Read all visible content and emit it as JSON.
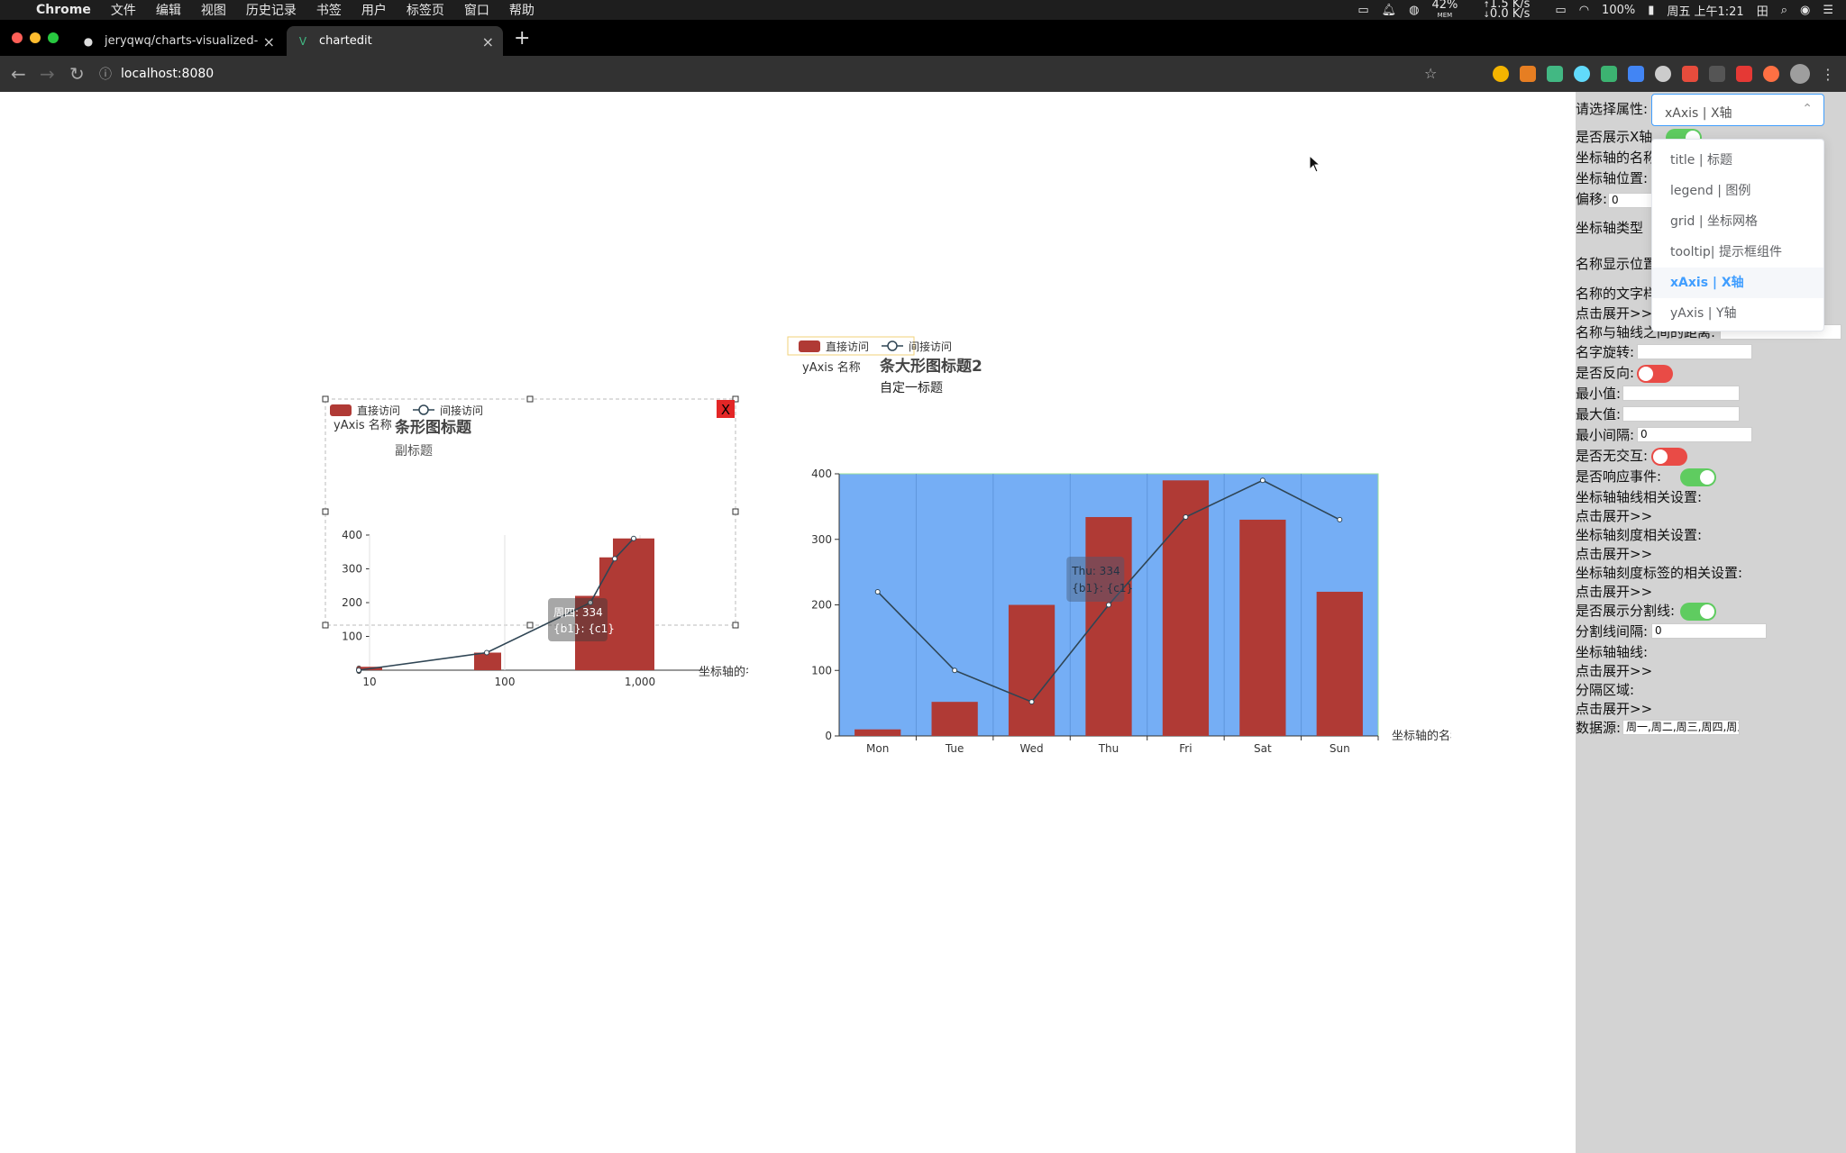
{
  "menubar": {
    "app": "Chrome",
    "items": [
      "文件",
      "编辑",
      "视图",
      "历史记录",
      "书签",
      "用户",
      "标签页",
      "窗口",
      "帮助"
    ],
    "status": {
      "mem": "42%",
      "mem_label": "MEM",
      "net_up": "1.5 K/s",
      "net_down": "0.0 K/s",
      "battery": "100%",
      "clock": "周五 上午1:21"
    }
  },
  "tabs": [
    {
      "title": "jeryqwq/charts-visualized-edit: [",
      "icon": "github-icon"
    },
    {
      "title": "chartedit",
      "icon": "vue-icon"
    }
  ],
  "address": {
    "url": "localhost:8080"
  },
  "colors": {
    "bar": "#b03a35",
    "line": "#2f4554",
    "plotbg": "#75aef5",
    "panel": "#d3d3d3",
    "accent": "#409eff"
  },
  "chart_data": [
    {
      "type": "bar",
      "title": "条形图标题",
      "subtitle": "副标题",
      "ylabel": "yAxis 名称",
      "xlabel": "坐标轴的名称",
      "xscale": "log",
      "xticks": [
        "10",
        "100",
        "1,000"
      ],
      "ylim": [
        0,
        400
      ],
      "yticks": [
        "0",
        "100",
        "200",
        "300",
        "400"
      ],
      "legend": [
        "直接访问",
        "间接访问"
      ],
      "close_label": "X",
      "x": [
        1,
        50,
        200,
        330,
        390
      ],
      "series": [
        {
          "name": "直接访问",
          "type": "bar",
          "values": [
            10,
            52,
            220,
            334,
            390
          ]
        },
        {
          "name": "间接访问",
          "type": "line",
          "values": [
            0,
            52,
            200,
            330,
            390
          ]
        }
      ],
      "tooltip": [
        "周四: 334",
        "{b1}: {c1}"
      ]
    },
    {
      "type": "bar",
      "title": "条大形图标题2",
      "subtitle": "自定一标题",
      "ylabel": "yAxis 名称",
      "xlabel": "坐标轴的名称",
      "categories": [
        "Mon",
        "Tue",
        "Wed",
        "Thu",
        "Fri",
        "Sat",
        "Sun"
      ],
      "ylim": [
        0,
        400
      ],
      "yticks": [
        "0",
        "100",
        "200",
        "300",
        "400"
      ],
      "legend": [
        "直接访问",
        "间接访问"
      ],
      "series": [
        {
          "name": "直接访问",
          "type": "bar",
          "values": [
            10,
            52,
            200,
            334,
            390,
            330,
            220
          ]
        },
        {
          "name": "间接访问",
          "type": "line",
          "values": [
            220,
            100,
            52,
            200,
            334,
            390,
            330
          ]
        }
      ],
      "tooltip": [
        "Thu: 334",
        "{b1}: {c1}"
      ]
    }
  ],
  "panel": {
    "select_label": "请选择属性:",
    "select_value": "xAxis | X轴",
    "options": [
      "title | 标题",
      "legend | 图例",
      "grid | 坐标网格",
      "tooltip| 提示框组件",
      "xAxis | X轴",
      "yAxis | Y轴"
    ],
    "show_x": "是否展示X轴",
    "axis_name": "坐标轴的名称",
    "axis_pos": "坐标轴位置:",
    "offset": "偏移:",
    "offset_val": "0",
    "axis_type": "坐标轴类型",
    "name_pos": "名称显示位置",
    "name_style": "名称的文字样式",
    "expand": "点击展开>>",
    "name_gap": "名称与轴线之间的距离:",
    "rotate": "名字旋转:",
    "inverse": "是否反向:",
    "min": "最小值:",
    "max": "最大值:",
    "min_interval": "最小间隔:",
    "min_interval_val": "0",
    "silent": "是否无交互:",
    "trigger": "是否响应事件:",
    "axisline": "坐标轴轴线相关设置:",
    "axistick": "坐标轴刻度相关设置:",
    "axislabel": "坐标轴刻度标签的相关设置:",
    "splitline": "是否展示分割线:",
    "split_interval": "分割线间隔:",
    "split_interval_val": "0",
    "minor": "坐标轴轴线:",
    "splitarea": "分隔区域:",
    "datasource": "数据源:",
    "datasource_val": "周一,周二,周三,周四,周五"
  }
}
